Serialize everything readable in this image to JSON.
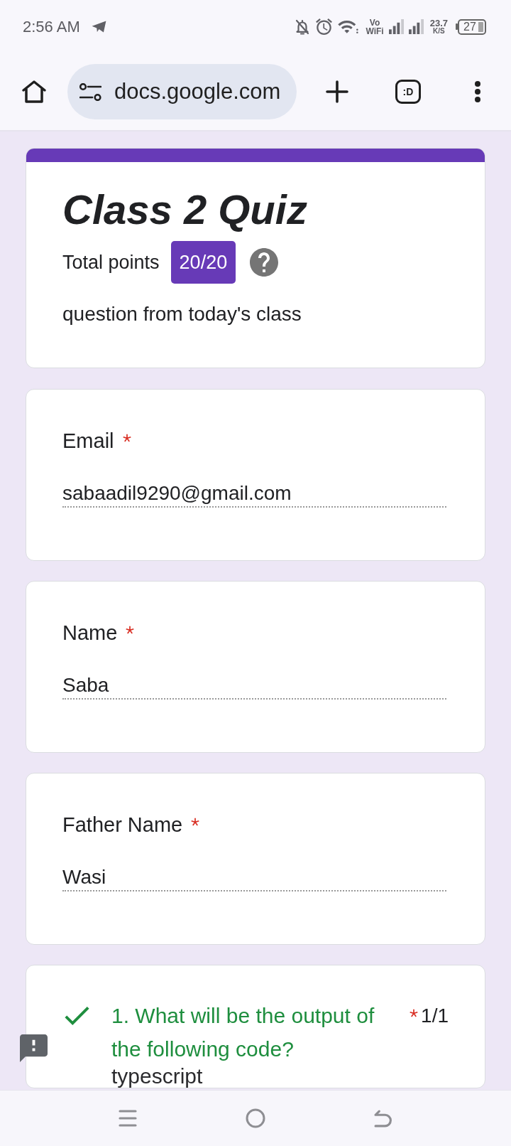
{
  "status_bar": {
    "time": "2:56 AM",
    "network_type": {
      "line_1": "Vo",
      "line_2": "WiFi"
    },
    "net_speed": {
      "value": "23.7",
      "unit": "K/S"
    },
    "battery": "27"
  },
  "browser_toolbar": {
    "url": "docs.google.com",
    "tab_count": ":D"
  },
  "form_header": {
    "title": "Class 2 Quiz",
    "total_points_label": "Total points",
    "score": "20/20",
    "description": "question from today's class"
  },
  "questions": [
    {
      "kind": "short_answer",
      "label": "Email",
      "required": true,
      "value": "sabaadil9290@gmail.com"
    },
    {
      "kind": "short_answer",
      "label": "Name",
      "required": true,
      "value": "Saba"
    },
    {
      "kind": "short_answer",
      "label": "Father Name",
      "required": true,
      "value": "Wasi"
    },
    {
      "kind": "graded",
      "title": "1. What will be the output of the following code?",
      "required": true,
      "correct": true,
      "points": "1/1",
      "detail": "typescript"
    }
  ]
}
